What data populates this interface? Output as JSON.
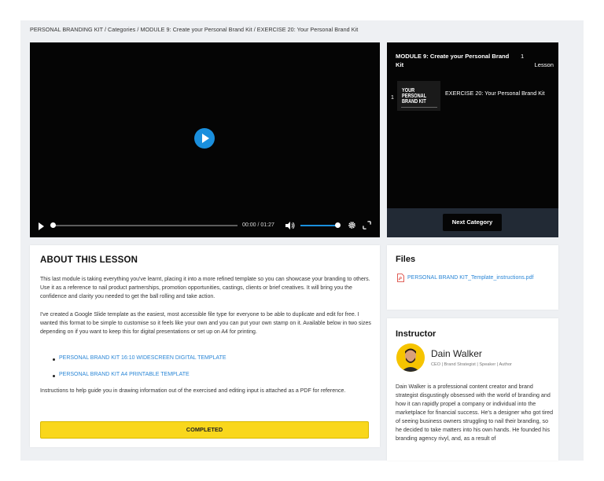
{
  "breadcrumb": "PERSONAL BRANDING KIT / Categories / MODULE 9: Create your Personal Brand Kit / EXERCISE 20: Your Personal Brand Kit",
  "player": {
    "time": "00:00 / 01:27",
    "progress": 0.0,
    "volume": 1.0,
    "accent": "#1a8fdd"
  },
  "playlist": {
    "title": "MODULE 9: Create your Personal Brand Kit",
    "count_num": "1",
    "count_label": "Lesson",
    "items": [
      {
        "index": "1",
        "thumb_text": "YOUR PERSONAL BRAND KIT",
        "title": "EXERCISE 20: Your Personal Brand Kit"
      }
    ],
    "next_label": "Next Category"
  },
  "about": {
    "title": "ABOUT THIS LESSON",
    "p1": "This last module is taking everything you've learnt, placing it into a more refined template so you can showcase your branding to others. Use it as a reference to nail product partnerships, promotion opportunities, castings, clients or brief creatives. It will bring you the confidence and clarity you needed to get the ball rolling and take action.",
    "p2": "I've created a Google Slide template as the easiest, most accessible file type for everyone to be able to duplicate and edit for free. I wanted this format to be simple to customise so it feels like your own and you can put your own stamp on it. Available below in two sizes depending on if you want to keep this for digital presentations or set up on A4 for printing.",
    "links": [
      "PERSONAL BRAND KIT 16:10 WIDESCREEN DIGITAL TEMPLATE",
      "PERSONAL BRAND KIT A4 PRINTABLE TEMPLATE"
    ],
    "p3": "Instructions to help guide you in drawing information out of the exercised and editing input is attached as a PDF for reference.",
    "completed_label": "COMPLETED"
  },
  "files": {
    "title": "Files",
    "file_name": "PERSONAL BRAND KIT_Template_instructions.pdf"
  },
  "instructor": {
    "title": "Instructor",
    "name": "Dain Walker",
    "role": "CEO | Brand Strategist | Speaker | Author",
    "bio": "Dain Walker is a professional content creator and brand strategist disgustingly obsessed with the world of branding and how it can rapidly propel a company or individual into the marketplace for financial success. He's a designer who got tired of seeing business owners struggling to nail their branding, so he decided to take matters into his own hands. He founded his branding agency rivyl, and, as a result of"
  },
  "colors": {
    "accent_blue": "#1a8fdd",
    "link_blue": "#2a86d6",
    "completed_yellow": "#f9d71c"
  }
}
